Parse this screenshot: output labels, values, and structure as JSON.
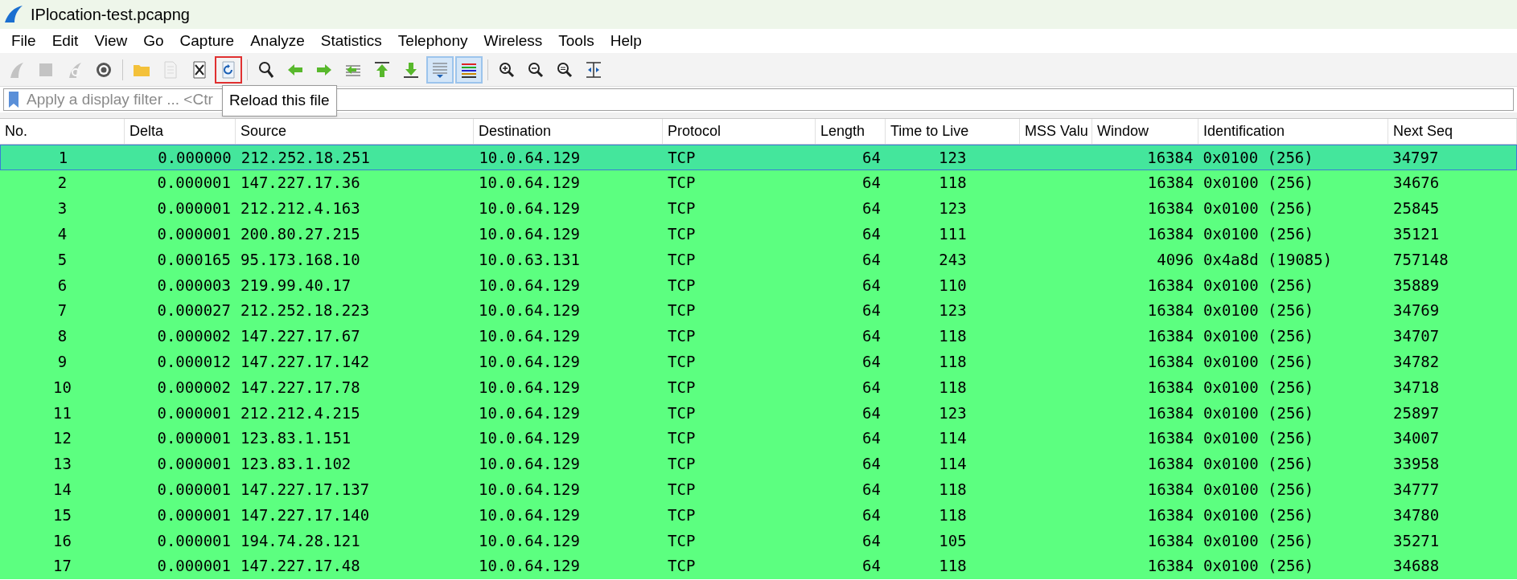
{
  "window": {
    "title": "IPlocation-test.pcapng"
  },
  "menu": [
    "File",
    "Edit",
    "View",
    "Go",
    "Capture",
    "Analyze",
    "Statistics",
    "Telephony",
    "Wireless",
    "Tools",
    "Help"
  ],
  "toolbar": [
    {
      "kind": "fin",
      "disabled": true,
      "pressed": false,
      "highlighted": false
    },
    {
      "kind": "stop",
      "disabled": true,
      "pressed": false,
      "highlighted": false
    },
    {
      "kind": "restart",
      "disabled": true,
      "pressed": false,
      "highlighted": false
    },
    {
      "kind": "gear",
      "disabled": false,
      "pressed": false,
      "highlighted": false
    },
    {
      "kind": "sep"
    },
    {
      "kind": "folder",
      "disabled": false,
      "pressed": false,
      "highlighted": false
    },
    {
      "kind": "doc",
      "disabled": true,
      "pressed": false,
      "highlighted": false
    },
    {
      "kind": "closefile",
      "disabled": false,
      "pressed": false,
      "highlighted": false
    },
    {
      "kind": "reload",
      "disabled": false,
      "pressed": false,
      "highlighted": true
    },
    {
      "kind": "sep"
    },
    {
      "kind": "search",
      "disabled": false,
      "pressed": false,
      "highlighted": false
    },
    {
      "kind": "back",
      "disabled": false,
      "pressed": false,
      "highlighted": false
    },
    {
      "kind": "forward",
      "disabled": false,
      "pressed": false,
      "highlighted": false
    },
    {
      "kind": "goto",
      "disabled": false,
      "pressed": false,
      "highlighted": false
    },
    {
      "kind": "first",
      "disabled": false,
      "pressed": false,
      "highlighted": false
    },
    {
      "kind": "last",
      "disabled": false,
      "pressed": false,
      "highlighted": false
    },
    {
      "kind": "autoscroll",
      "disabled": false,
      "pressed": true,
      "highlighted": false
    },
    {
      "kind": "colorize",
      "disabled": false,
      "pressed": true,
      "highlighted": false
    },
    {
      "kind": "sep"
    },
    {
      "kind": "zoomin",
      "disabled": false,
      "pressed": false,
      "highlighted": false
    },
    {
      "kind": "zoomout",
      "disabled": false,
      "pressed": false,
      "highlighted": false
    },
    {
      "kind": "zoomreset",
      "disabled": false,
      "pressed": false,
      "highlighted": false
    },
    {
      "kind": "resize",
      "disabled": false,
      "pressed": false,
      "highlighted": false
    }
  ],
  "tooltip": "Reload this file",
  "filter": {
    "placeholder": "Apply a display filter ... <Ctr"
  },
  "table": {
    "columns": [
      "No.",
      "Delta",
      "Source",
      "Destination",
      "Protocol",
      "Length",
      "Time to Live",
      "MSS Valu",
      "Window",
      "Identification",
      "Next Seq"
    ],
    "rows": [
      {
        "selected": true,
        "cells": [
          "1",
          "0.000000",
          "212.252.18.251",
          "10.0.64.129",
          "TCP",
          "64",
          "123",
          "",
          "16384",
          "0x0100 (256)",
          "34797"
        ]
      },
      {
        "selected": false,
        "cells": [
          "2",
          "0.000001",
          "147.227.17.36",
          "10.0.64.129",
          "TCP",
          "64",
          "118",
          "",
          "16384",
          "0x0100 (256)",
          "34676"
        ]
      },
      {
        "selected": false,
        "cells": [
          "3",
          "0.000001",
          "212.212.4.163",
          "10.0.64.129",
          "TCP",
          "64",
          "123",
          "",
          "16384",
          "0x0100 (256)",
          "25845"
        ]
      },
      {
        "selected": false,
        "cells": [
          "4",
          "0.000001",
          "200.80.27.215",
          "10.0.64.129",
          "TCP",
          "64",
          "111",
          "",
          "16384",
          "0x0100 (256)",
          "35121"
        ]
      },
      {
        "selected": false,
        "cells": [
          "5",
          "0.000165",
          "95.173.168.10",
          "10.0.63.131",
          "TCP",
          "64",
          "243",
          "",
          "4096",
          "0x4a8d (19085)",
          "757148"
        ]
      },
      {
        "selected": false,
        "cells": [
          "6",
          "0.000003",
          "219.99.40.17",
          "10.0.64.129",
          "TCP",
          "64",
          "110",
          "",
          "16384",
          "0x0100 (256)",
          "35889"
        ]
      },
      {
        "selected": false,
        "cells": [
          "7",
          "0.000027",
          "212.252.18.223",
          "10.0.64.129",
          "TCP",
          "64",
          "123",
          "",
          "16384",
          "0x0100 (256)",
          "34769"
        ]
      },
      {
        "selected": false,
        "cells": [
          "8",
          "0.000002",
          "147.227.17.67",
          "10.0.64.129",
          "TCP",
          "64",
          "118",
          "",
          "16384",
          "0x0100 (256)",
          "34707"
        ]
      },
      {
        "selected": false,
        "cells": [
          "9",
          "0.000012",
          "147.227.17.142",
          "10.0.64.129",
          "TCP",
          "64",
          "118",
          "",
          "16384",
          "0x0100 (256)",
          "34782"
        ]
      },
      {
        "selected": false,
        "cells": [
          "10",
          "0.000002",
          "147.227.17.78",
          "10.0.64.129",
          "TCP",
          "64",
          "118",
          "",
          "16384",
          "0x0100 (256)",
          "34718"
        ]
      },
      {
        "selected": false,
        "cells": [
          "11",
          "0.000001",
          "212.212.4.215",
          "10.0.64.129",
          "TCP",
          "64",
          "123",
          "",
          "16384",
          "0x0100 (256)",
          "25897"
        ]
      },
      {
        "selected": false,
        "cells": [
          "12",
          "0.000001",
          "123.83.1.151",
          "10.0.64.129",
          "TCP",
          "64",
          "114",
          "",
          "16384",
          "0x0100 (256)",
          "34007"
        ]
      },
      {
        "selected": false,
        "cells": [
          "13",
          "0.000001",
          "123.83.1.102",
          "10.0.64.129",
          "TCP",
          "64",
          "114",
          "",
          "16384",
          "0x0100 (256)",
          "33958"
        ]
      },
      {
        "selected": false,
        "cells": [
          "14",
          "0.000001",
          "147.227.17.137",
          "10.0.64.129",
          "TCP",
          "64",
          "118",
          "",
          "16384",
          "0x0100 (256)",
          "34777"
        ]
      },
      {
        "selected": false,
        "cells": [
          "15",
          "0.000001",
          "147.227.17.140",
          "10.0.64.129",
          "TCP",
          "64",
          "118",
          "",
          "16384",
          "0x0100 (256)",
          "34780"
        ]
      },
      {
        "selected": false,
        "cells": [
          "16",
          "0.000001",
          "194.74.28.121",
          "10.0.64.129",
          "TCP",
          "64",
          "105",
          "",
          "16384",
          "0x0100 (256)",
          "35271"
        ]
      },
      {
        "selected": false,
        "cells": [
          "17",
          "0.000001",
          "147.227.17.48",
          "10.0.64.129",
          "TCP",
          "64",
          "118",
          "",
          "16384",
          "0x0100 (256)",
          "34688"
        ]
      }
    ]
  }
}
